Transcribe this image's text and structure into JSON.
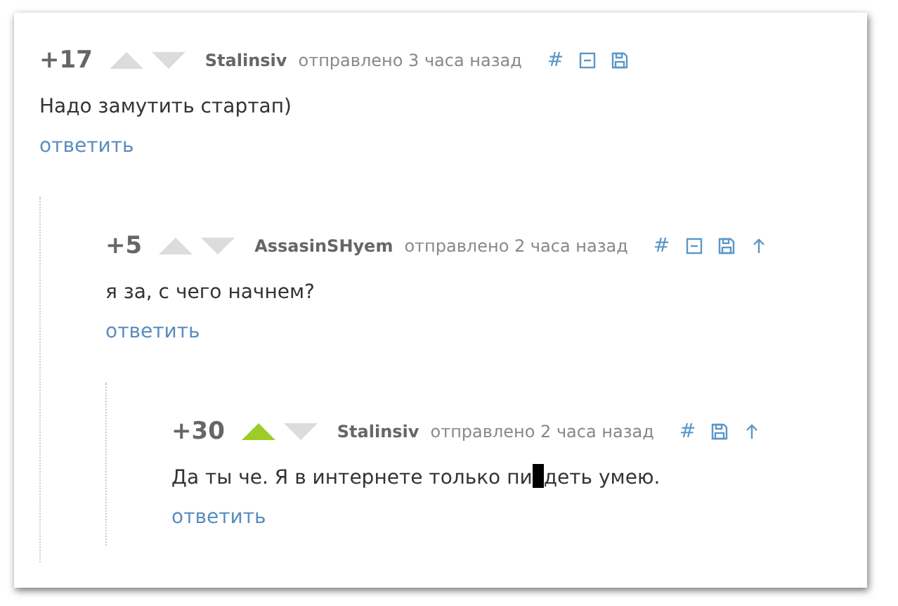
{
  "comments": [
    {
      "score": "+17",
      "upvoted": false,
      "downvoted": false,
      "author": "Stalinsiv",
      "time": "отправлено 3 часа назад",
      "actions": [
        {
          "kind": "link",
          "label": "#"
        },
        {
          "kind": "collapse"
        },
        {
          "kind": "save"
        }
      ],
      "body": "Надо замутить стартап)",
      "reply": "ответить",
      "children": [
        {
          "score": "+5",
          "upvoted": false,
          "downvoted": false,
          "author": "AssasinSHyem",
          "time": "отправлено 2 часа назад",
          "actions": [
            {
              "kind": "link",
              "label": "#"
            },
            {
              "kind": "collapse"
            },
            {
              "kind": "save"
            },
            {
              "kind": "parent"
            }
          ],
          "body": "я за, с чего начнем?",
          "reply": "ответить",
          "children": [
            {
              "score": "+30",
              "upvoted": true,
              "downvoted": false,
              "author": "Stalinsiv",
              "time": "отправлено 2 часа назад",
              "actions": [
                {
                  "kind": "link",
                  "label": "#"
                },
                {
                  "kind": "save"
                },
                {
                  "kind": "parent"
                }
              ],
              "body": "Да ты че. Я в интернете только пи",
              "censored": true,
              "body_after": "деть умею.",
              "reply": "ответить"
            }
          ]
        }
      ]
    }
  ]
}
